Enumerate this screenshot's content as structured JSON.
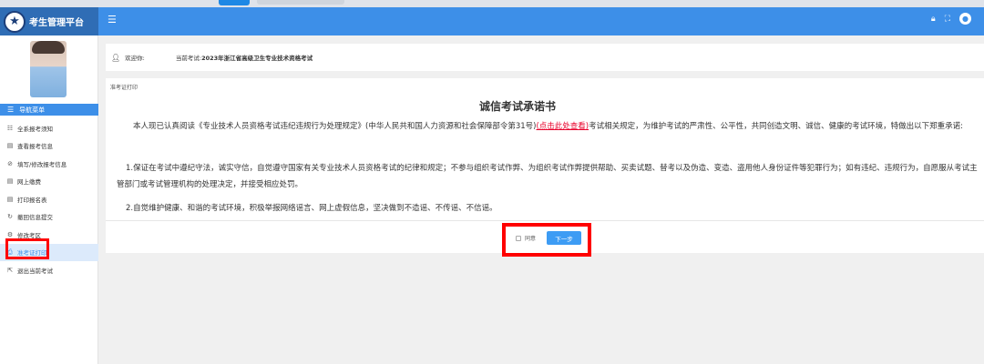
{
  "header": {
    "title": "考生管理平台",
    "menu_toggle_icon": "hamburger-icon",
    "icons": [
      "lock-icon",
      "fullscreen-icon",
      "user-icon"
    ],
    "accent_color": "#3d8fe8"
  },
  "sidebar": {
    "nav_title": "导航菜单",
    "items": [
      {
        "label": "全系报考须知",
        "icon": "list-icon"
      },
      {
        "label": "查看报考信息",
        "icon": "document-icon"
      },
      {
        "label": "填写/修改报考信息",
        "icon": "edit-icon"
      },
      {
        "label": "网上缴费",
        "icon": "document-icon"
      },
      {
        "label": "打印报名表",
        "icon": "document-icon"
      },
      {
        "label": "撤回信息提交",
        "icon": "undo-icon"
      },
      {
        "label": "修改考区",
        "icon": "settings-icon"
      },
      {
        "label": "准考证打印",
        "icon": "print-icon",
        "active": true
      },
      {
        "label": "退出当前考试",
        "icon": "logout-icon"
      }
    ]
  },
  "welcome": {
    "greeting": "欢迎你:",
    "current_exam_label": "当前考试:",
    "current_exam": "2023年浙江省高级卫生专业技术资格考试"
  },
  "main": {
    "breadcrumb": "准考证打印",
    "title": "诚信考试承诺书",
    "para1_before_link": "本人现已认真阅读《专业技术人员资格考试违纪违规行为处理规定》(中华人民共和国人力资源和社会保障部令第31号)",
    "para1_link": "(点击此处查看)",
    "para1_after_link": "考试相关规定，为维护考试的严肃性、公平性，共同创造文明、诚信、健康的考试环境，特做出以下郑重承诺:",
    "para2": "1.保证在考试中遵纪守法，诚实守信，自觉遵守国家有关专业技术人员资格考试的纪律和规定；不参与组织考试作弊、为组织考试作弊提供帮助、买卖试题、替考以及伪造、变造、盗用他人身份证件等犯罪行为；如有违纪、违规行为，自愿服从考试主管部门或考试管理机构的处理决定，并接受相应处罚。",
    "para3": "2.自觉维护健康、和谐的考试环境，积极举报网络谣言、网上虚假信息，坚决做到不造谣、不传谣、不信谣。",
    "agree_label": "同意",
    "next_button": "下一步"
  }
}
